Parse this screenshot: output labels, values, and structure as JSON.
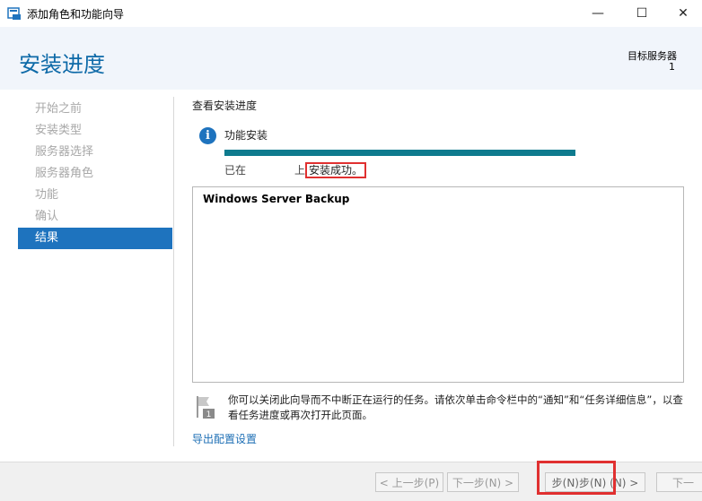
{
  "window": {
    "title": "添加角色和功能向导",
    "minimize_glyph": "—",
    "maximize_glyph": "☐",
    "close_glyph": "✕"
  },
  "header": {
    "page_title": "安装进度",
    "target_label": "目标服务器",
    "target_value": "1"
  },
  "nav": {
    "items": [
      {
        "label": "开始之前",
        "active": false
      },
      {
        "label": "安装类型",
        "active": false
      },
      {
        "label": "服务器选择",
        "active": false
      },
      {
        "label": "服务器角色",
        "active": false
      },
      {
        "label": "功能",
        "active": false
      },
      {
        "label": "确认",
        "active": false
      },
      {
        "label": "结果",
        "active": true
      }
    ]
  },
  "main": {
    "section_title": "查看安装进度",
    "feature_label": "功能安装",
    "progress_percent": 100,
    "status_prefix": "已在",
    "status_server": "",
    "status_suffix": "上",
    "status_success": "安装成功。",
    "results": [
      "Windows Server Backup"
    ],
    "note": "你可以关闭此向导而不中断正在运行的任务。请依次单击命令栏中的“通知”和“任务详细信息”，以查看任务进度或再次打开此页面。",
    "export_link": "导出配置设置"
  },
  "footer": {
    "prev_label": "< 上一步(P)",
    "next_label": "下一步(N) >",
    "install_label": "步(N)步(N)  (N) >",
    "cancel_label": "下一"
  },
  "colors": {
    "accent": "#1e73be",
    "title_blue": "#0e6aa8",
    "progress": "#0e7b8e",
    "highlight": "#e03030"
  }
}
